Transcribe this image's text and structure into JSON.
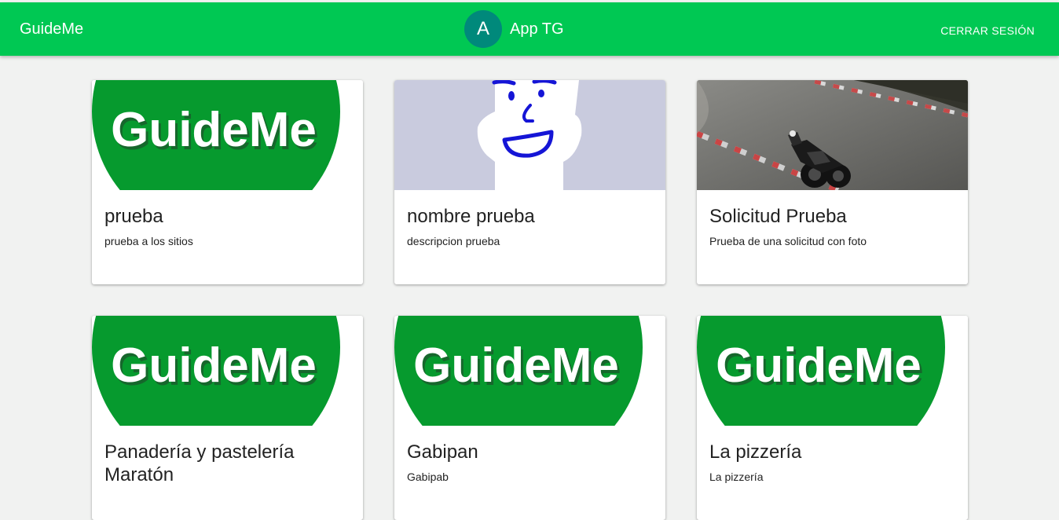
{
  "topbar": {
    "brand": "GuideMe",
    "avatar_initial": "A",
    "app_name": "App TG",
    "logout_label": "CERRAR SESIÓN"
  },
  "cards": [
    {
      "title": "prueba",
      "description": "prueba a los sitios",
      "image": "guideme-logo"
    },
    {
      "title": "nombre prueba",
      "description": "descripcion prueba",
      "image": "face-drawing"
    },
    {
      "title": "Solicitud Prueba",
      "description": "Prueba de una solicitud con foto",
      "image": "motorcycle-photo"
    },
    {
      "title": "Panadería y pastelería Maratón",
      "description": "",
      "image": "guideme-logo"
    },
    {
      "title": "Gabipan",
      "description": "Gabipab",
      "image": "guideme-logo"
    },
    {
      "title": "La pizzería",
      "description": "La pizzería",
      "image": "guideme-logo"
    }
  ],
  "logo_text": "GuideMe",
  "colors": {
    "topbar": "#00c853",
    "avatar": "#00897b",
    "logo_green": "#069a2e"
  }
}
